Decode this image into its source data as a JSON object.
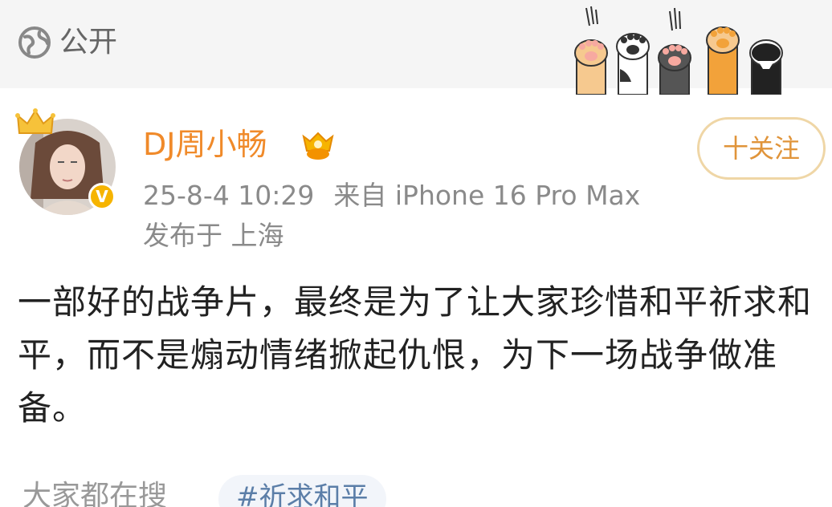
{
  "header": {
    "visibility_icon": "globe-icon",
    "visibility_label": "公开",
    "decoration_icon": "cat-paws-icon"
  },
  "post": {
    "author_name": "DJ周小畅",
    "author_badge_icon": "gold-crown-badge-icon",
    "avatar_verified_icon": "verified-v-icon",
    "avatar_verified_glyph": "V",
    "follow_label": "十关注",
    "date_time": "25-8-4 10:29",
    "source": "来自 iPhone 16 Pro Max",
    "location": "发布于 上海",
    "content": "一部好的战争片，最终是为了让大家珍惜和平祈求和平，而不是煽动情绪掀起仇恨，为下一场战争做准备。"
  },
  "footer": {
    "label": "大家都在搜",
    "tag": "#祈求和平"
  },
  "colors": {
    "name": "#f08a2a",
    "follow_border": "#efd6a6",
    "follow_text": "#e0943a",
    "meta": "#8a8a8a",
    "tag_text": "#5b7ea8"
  }
}
